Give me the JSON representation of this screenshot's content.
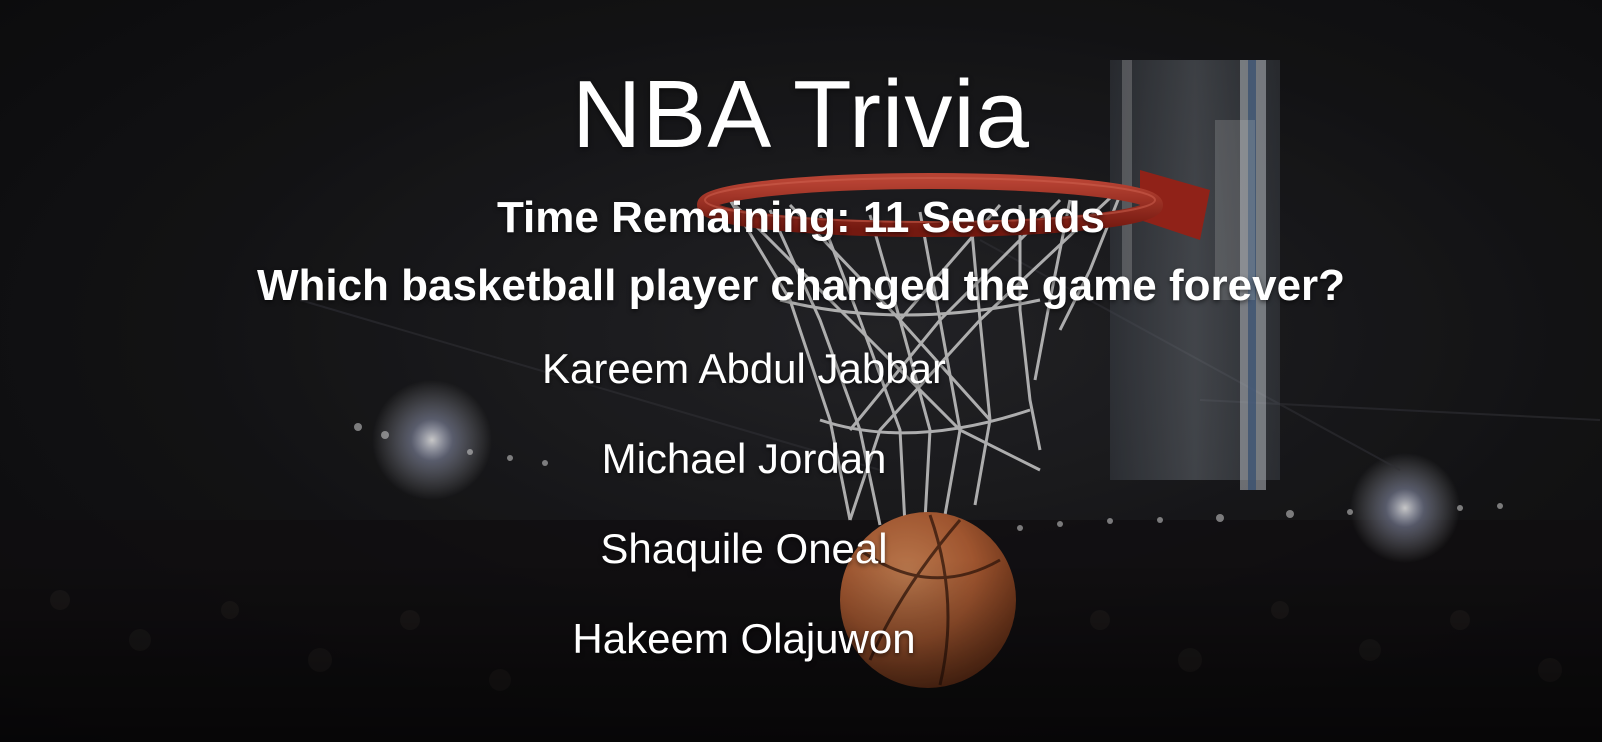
{
  "page": {
    "title": "NBA Trivia"
  },
  "timer": {
    "text": "Time Remaining: 11 Seconds"
  },
  "question": {
    "text": "Which basketball player changed the game forever?"
  },
  "answers": [
    {
      "label": "Kareem Abdul Jabbar"
    },
    {
      "label": "Michael Jordan"
    },
    {
      "label": "Shaquile Oneal"
    },
    {
      "label": "Hakeem Olajuwon"
    }
  ],
  "colors": {
    "text": "#ffffff",
    "background": "#141416",
    "rim": "#c0392b",
    "ball": "#c76a3a"
  }
}
